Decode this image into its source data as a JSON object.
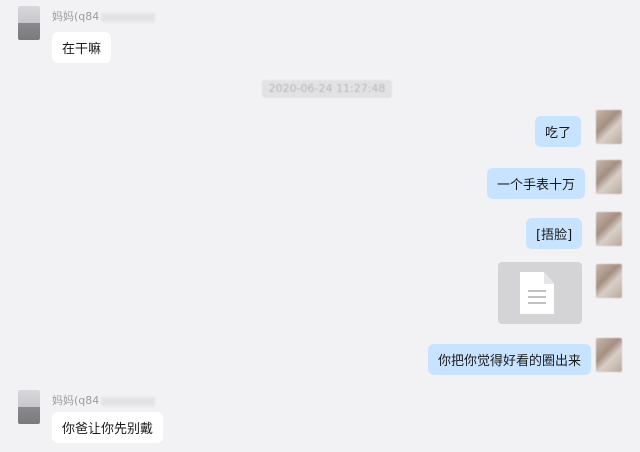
{
  "messages": {
    "m1": {
      "sender": "妈妈(q84",
      "text": "在干嘛"
    },
    "timestamp": "2020-06-24 11:27:48",
    "m2": {
      "text": "吃了"
    },
    "m3": {
      "text": "一个手表十万"
    },
    "m4": {
      "text": "[捂脸]"
    },
    "m5": {
      "type": "file",
      "icon": "document-icon"
    },
    "m6": {
      "text": "你把你觉得好看的圈出来"
    },
    "m7": {
      "sender": "妈妈(q84",
      "text": "你爸让你先别戴"
    }
  },
  "colors": {
    "background": "#f2f1f3",
    "incoming_bubble": "#ffffff",
    "outgoing_bubble": "#c7e3ff"
  }
}
